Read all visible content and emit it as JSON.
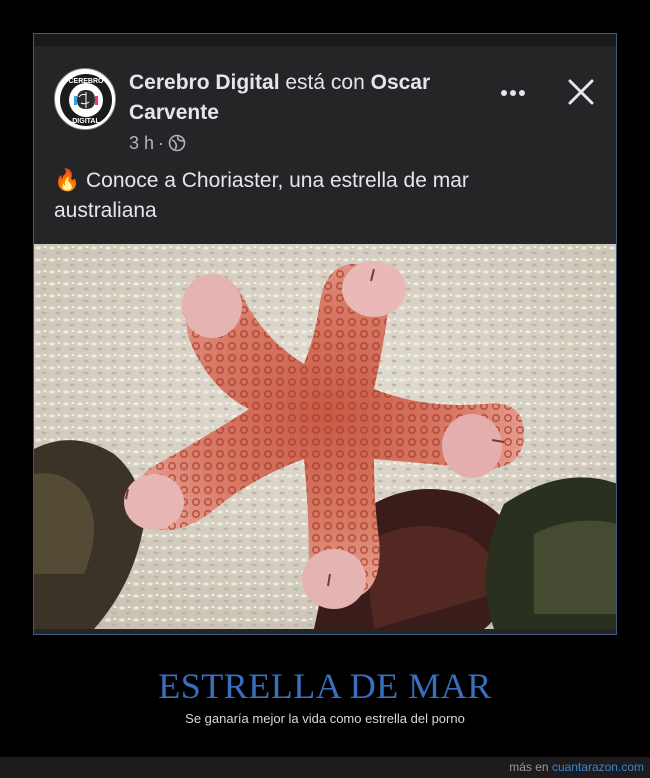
{
  "post": {
    "author": "Cerebro Digital",
    "connector": "está con",
    "tagged": "Oscar Carvente",
    "time": "3 h",
    "separator": "·",
    "privacy_icon": "globe-icon",
    "fire_emoji": "🔥",
    "text": "Conoce a Choriaster, una estrella de mar australiana",
    "avatar_logo_top": "CEREBRO",
    "avatar_logo_bottom": "DIGITAL",
    "more_icon": "more-horizontal-icon",
    "close_icon": "close-icon"
  },
  "caption": {
    "title": "ESTRELLA DE MAR",
    "subtitle": "Se ganaría mejor la vida como estrella del porno"
  },
  "footer": {
    "prefix": "más en",
    "link": "cuantarazon.com"
  },
  "colors": {
    "caption_title": "#3a6fc0",
    "link": "#3d83d6",
    "post_bg": "#242526"
  }
}
